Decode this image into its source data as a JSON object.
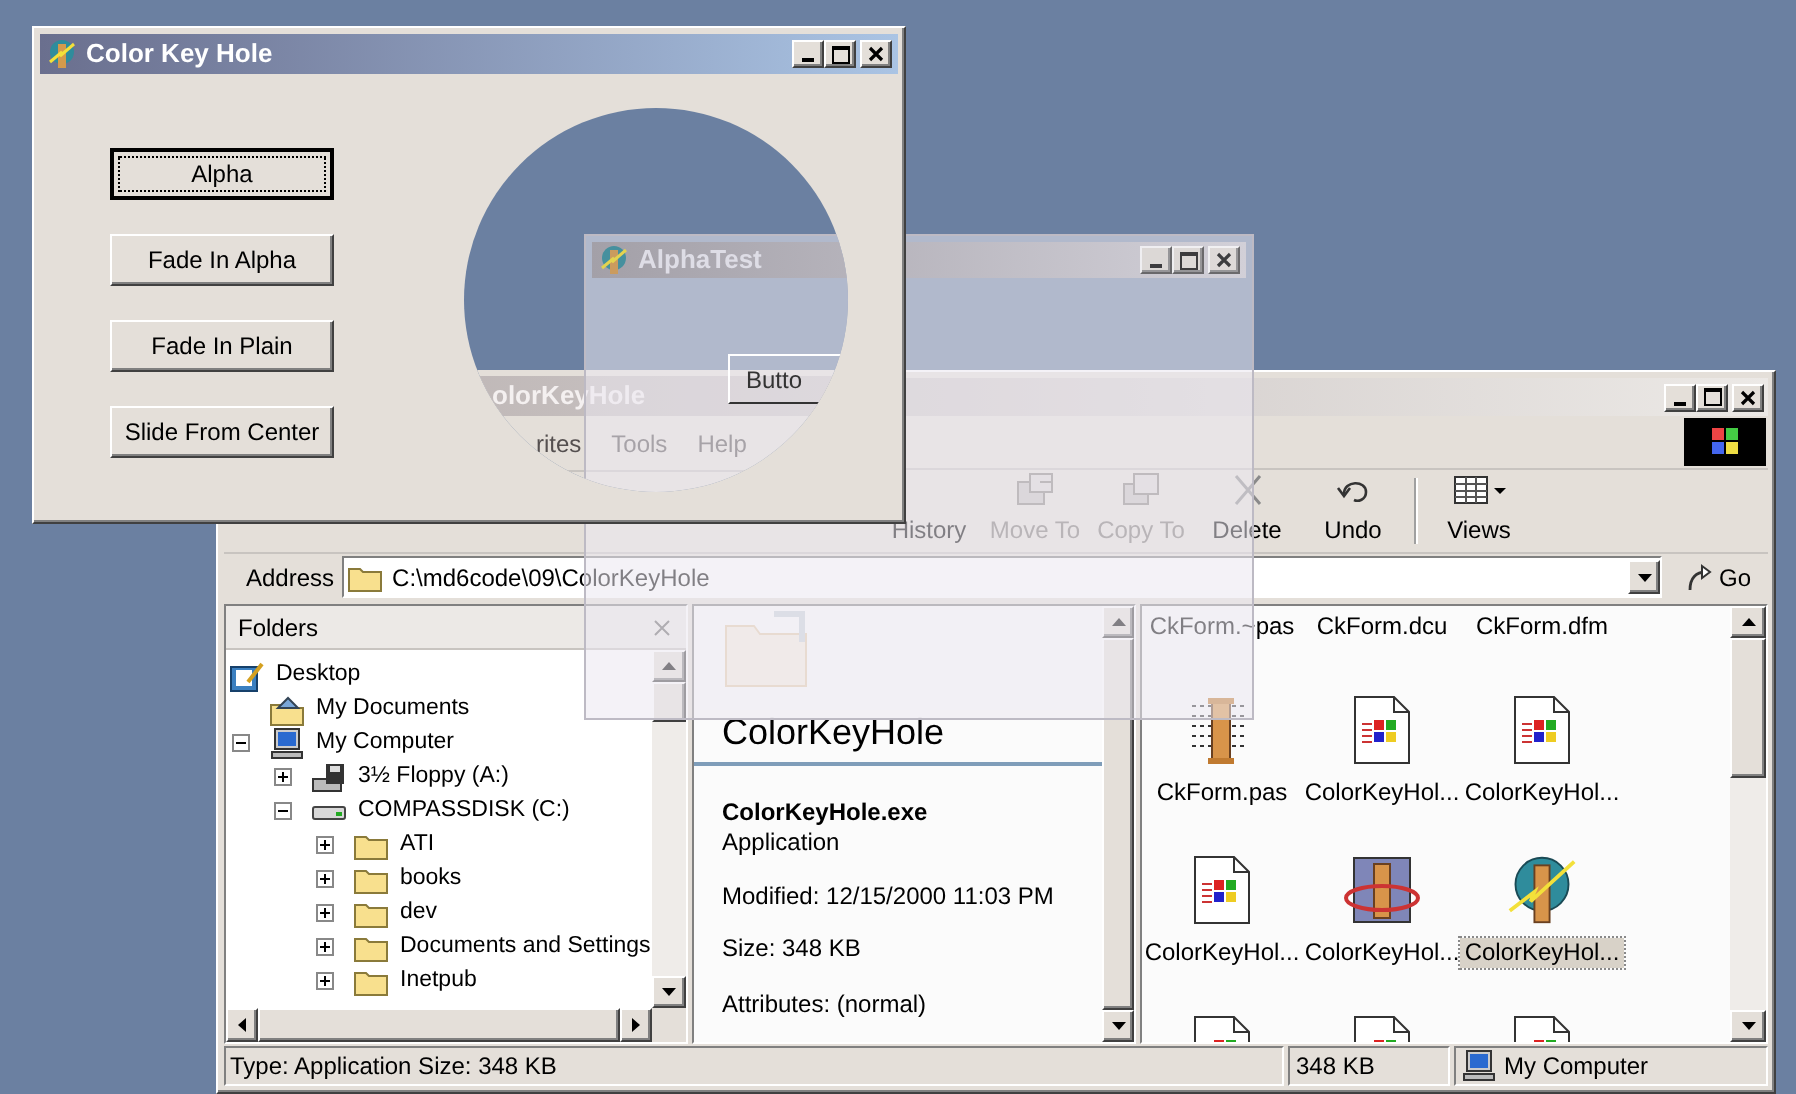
{
  "color_key_hole_window": {
    "title": "Color Key Hole",
    "buttons": [
      {
        "label": "Alpha",
        "focused": true
      },
      {
        "label": "Fade In Alpha",
        "focused": false
      },
      {
        "label": "Fade In Plain",
        "focused": false
      },
      {
        "label": "Slide From Center",
        "focused": false
      }
    ]
  },
  "alpha_test_window": {
    "title": "AlphaTest",
    "button": "Butto"
  },
  "explorer_window": {
    "title": "olorKeyHole",
    "menu": [
      "rites",
      "Tools",
      "Help"
    ],
    "toolbar": [
      {
        "kind": "history",
        "label": "History",
        "disabled": false
      },
      {
        "kind": "move",
        "label": "Move To",
        "disabled": true
      },
      {
        "kind": "copy",
        "label": "Copy To",
        "disabled": true
      },
      {
        "kind": "delete",
        "label": "Delete",
        "disabled": false
      },
      {
        "kind": "undo",
        "label": "Undo",
        "disabled": false
      },
      {
        "kind": "views",
        "label": "Views",
        "disabled": false
      }
    ],
    "address": {
      "label": "Address",
      "value": "C:\\md6code\\09\\ColorKeyHole"
    },
    "go_button": "Go",
    "folders": {
      "title": "Folders",
      "tree": [
        {
          "label": "Desktop",
          "kind": "desktop",
          "children": [
            {
              "label": "My Documents",
              "kind": "documents"
            },
            {
              "label": "My Computer",
              "kind": "computer",
              "expanded": true,
              "children": [
                {
                  "label": "3½ Floppy (A:)",
                  "kind": "floppy",
                  "expanded": false
                },
                {
                  "label": "COMPASSDISK (C:)",
                  "kind": "drive",
                  "expanded": true,
                  "children": [
                    {
                      "label": "ATI",
                      "kind": "folder",
                      "expanded": false
                    },
                    {
                      "label": "books",
                      "kind": "folder",
                      "expanded": false
                    },
                    {
                      "label": "dev",
                      "kind": "folder",
                      "expanded": false
                    },
                    {
                      "label": "Documents and Settings",
                      "kind": "folder",
                      "expanded": false
                    },
                    {
                      "label": "Inetpub",
                      "kind": "folder",
                      "expanded": false
                    }
                  ]
                }
              ]
            }
          ]
        }
      ]
    },
    "details": {
      "title": "ColorKeyHole",
      "file": "ColorKeyHole.exe",
      "type": "Application",
      "modified": "Modified: 12/15/2000 11:03 PM",
      "size": "Size: 348 KB",
      "attributes": "Attributes: (normal)"
    },
    "files": [
      {
        "name": "CkForm.~pas",
        "kind": "none",
        "selected": false
      },
      {
        "name": "CkForm.dcu",
        "kind": "none",
        "selected": false
      },
      {
        "name": "CkForm.dfm",
        "kind": "none",
        "selected": false
      },
      {
        "name": "CkForm.pas",
        "kind": "source",
        "selected": false
      },
      {
        "name": "ColorKeyHol...",
        "kind": "document",
        "selected": false
      },
      {
        "name": "ColorKeyHol...",
        "kind": "document",
        "selected": false
      },
      {
        "name": "ColorKeyHol...",
        "kind": "document",
        "selected": false
      },
      {
        "name": "ColorKeyHol...",
        "kind": "project",
        "selected": false
      },
      {
        "name": "ColorKeyHol...",
        "kind": "application",
        "selected": true
      },
      {
        "kind": "document",
        "selected": false
      },
      {
        "kind": "document",
        "selected": false
      },
      {
        "kind": "document",
        "selected": false
      }
    ],
    "status_bar": [
      "Type: Application Size: 348 KB",
      "348 KB",
      "My Computer"
    ]
  }
}
